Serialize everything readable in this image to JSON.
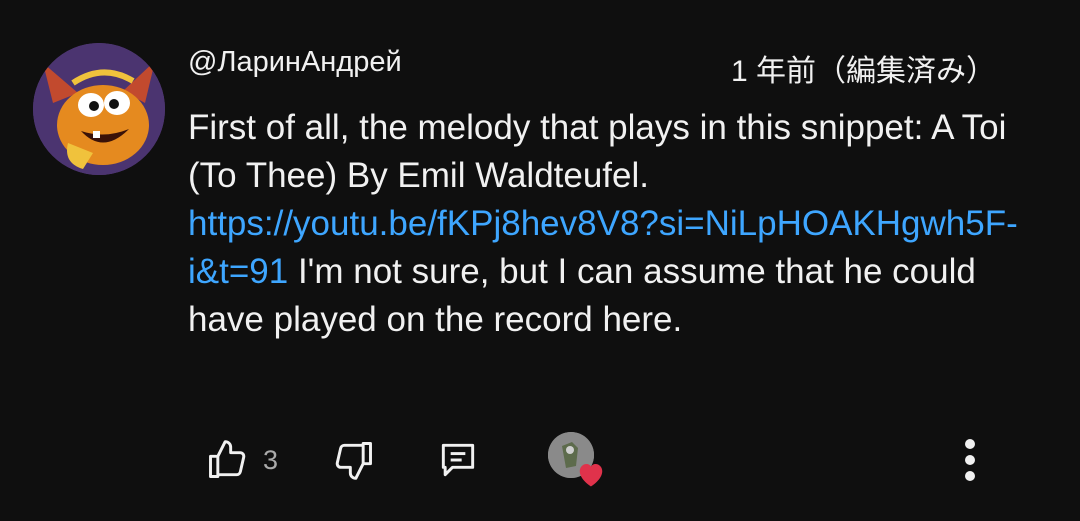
{
  "comment": {
    "author": "@ЛаринАндрей",
    "timestamp": "1 年前（編集済み）",
    "text_before_link": "First of all, the melody that plays in this snippet: A Toi (To Thee) By Emil Waldteufel. ",
    "link_text": "https://youtu.be/fKPj8hev8V8?si=NiLpHOAKHgwh5F-i&t=91",
    "text_after_link": " I'm not sure, but I can assume that he could have played on the record here.",
    "like_count": "3"
  },
  "icons": {
    "like": "thumbs-up-icon",
    "dislike": "thumbs-down-icon",
    "reply": "comment-icon",
    "creator_heart": "heart-icon",
    "more": "more-vertical-icon"
  },
  "colors": {
    "background": "#0f0f0f",
    "text": "#f1f1f1",
    "link": "#3ea6ff",
    "secondary": "#aaaaaa",
    "heart": "#e0324b"
  }
}
